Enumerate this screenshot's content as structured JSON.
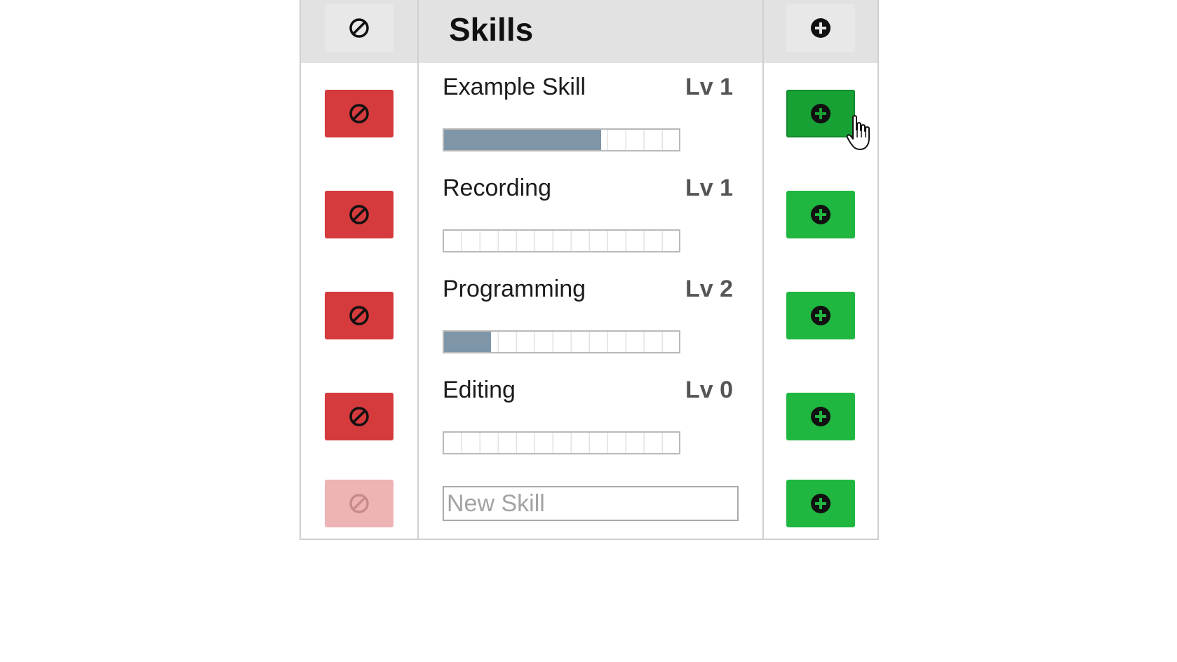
{
  "header": {
    "title": "Skills",
    "remove_all_icon": "prohibit-icon",
    "add_all_icon": "plus-circle-icon"
  },
  "skills": [
    {
      "name": "Example Skill",
      "level": "Lv 1",
      "progress": 0.67
    },
    {
      "name": "Recording",
      "level": "Lv 1",
      "progress": 0.0
    },
    {
      "name": "Programming",
      "level": "Lv 2",
      "progress": 0.2
    },
    {
      "name": "Editing",
      "level": "Lv 0",
      "progress": 0.0
    }
  ],
  "new_skill": {
    "placeholder": "New Skill",
    "value": ""
  },
  "colors": {
    "remove": "#d53a3d",
    "remove_disabled": "#eeb3b4",
    "add": "#1fb740",
    "progress": "#7f96a9",
    "header_bg": "#e2e2e2"
  }
}
